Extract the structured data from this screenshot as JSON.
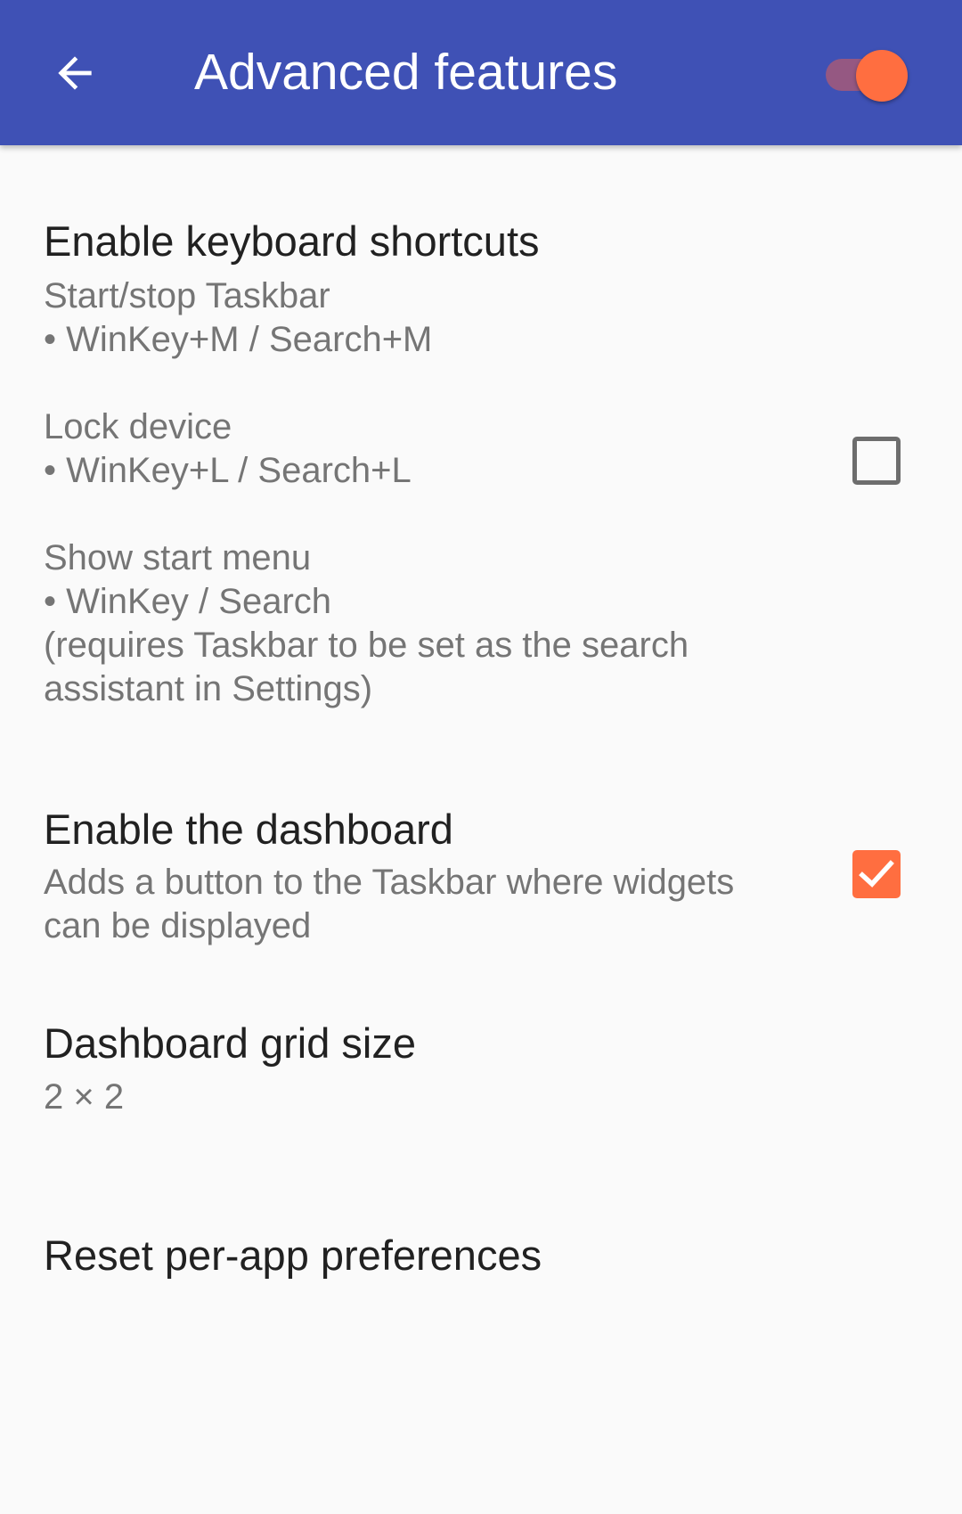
{
  "appbar": {
    "title": "Advanced features",
    "back_icon": "arrow-back-icon",
    "master_switch_on": true,
    "background_color": "#3f51b5",
    "accent_color": "#ff6e40"
  },
  "prefs": {
    "keyboard": {
      "title": "Enable keyboard shortcuts",
      "summary": "Start/stop Taskbar\n• WinKey+M / Search+M\n\nLock device\n• WinKey+L / Search+L\n\nShow start menu\n• WinKey / Search\n(requires Taskbar to be set as the search\nassistant in Settings)",
      "checked": false
    },
    "dashboard": {
      "title": "Enable the dashboard",
      "summary": "Adds a button to the Taskbar where widgets\ncan be displayed",
      "checked": true
    },
    "grid": {
      "title": "Dashboard grid size",
      "summary": "2 × 2"
    },
    "reset": {
      "title": "Reset per-app preferences"
    }
  }
}
